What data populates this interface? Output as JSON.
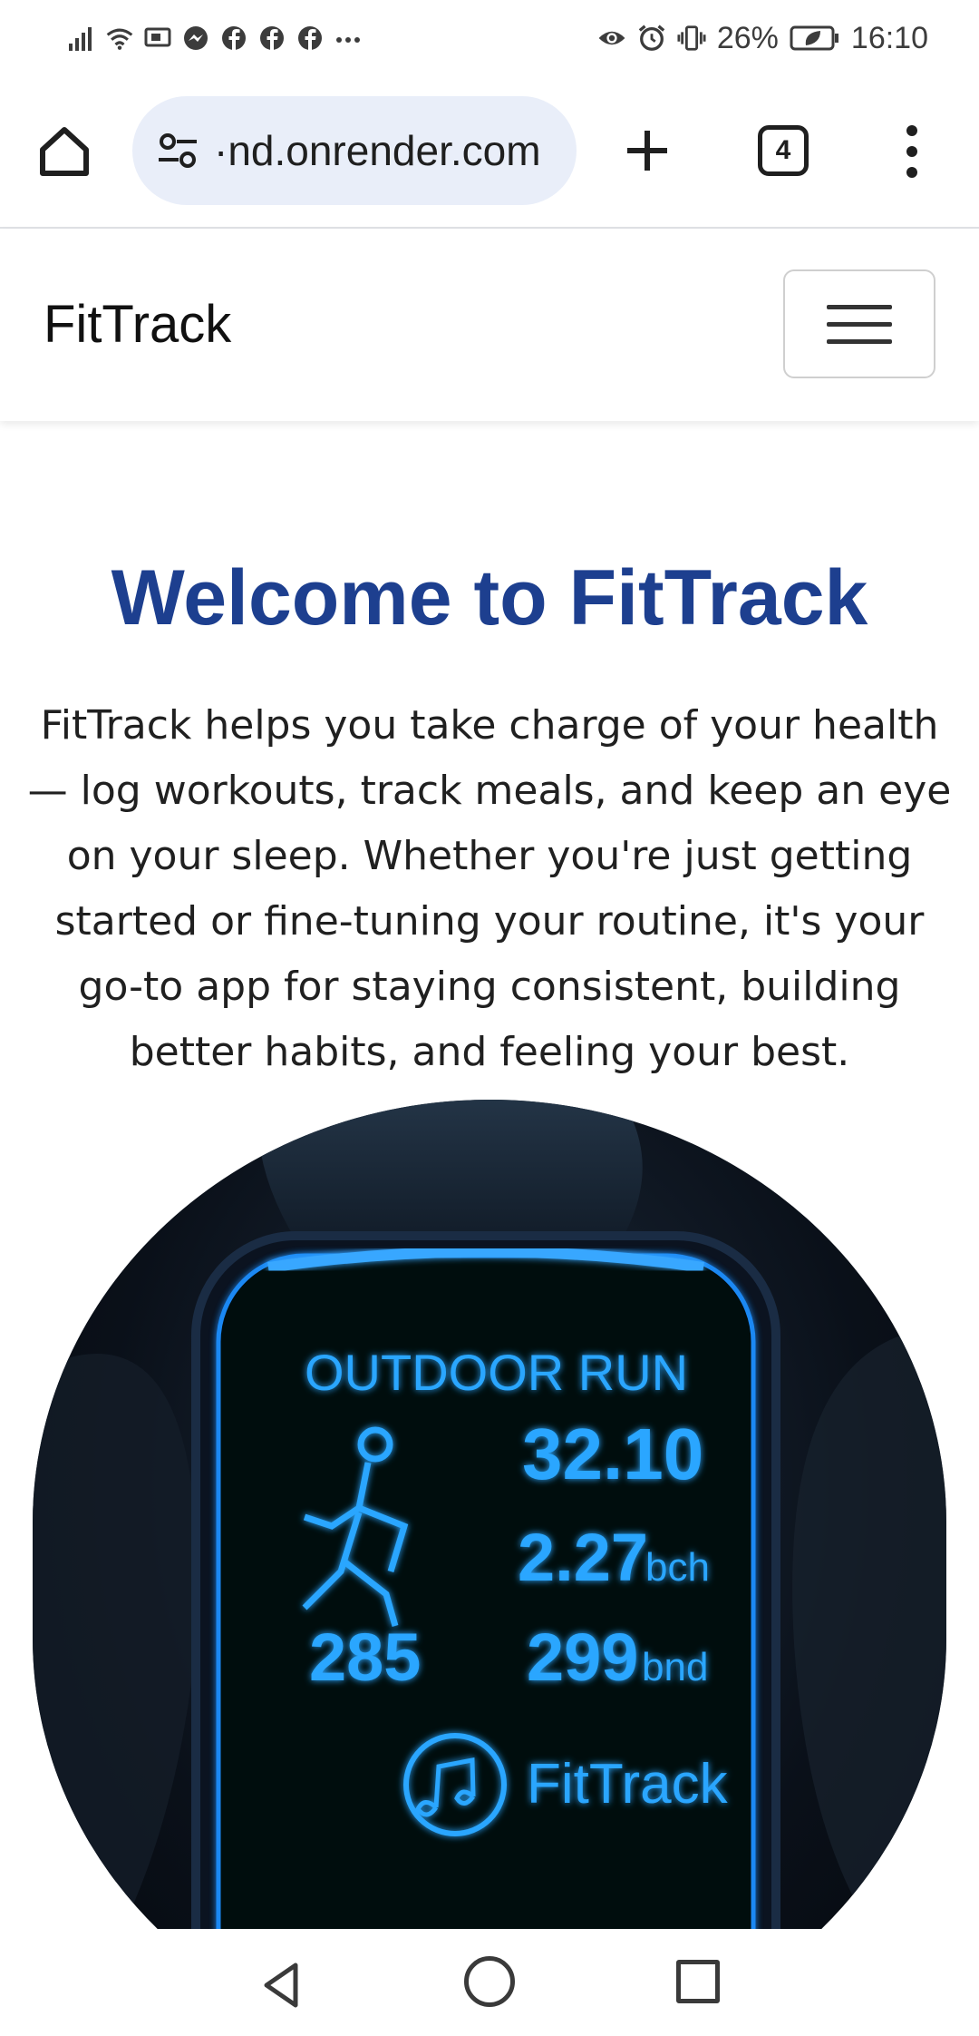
{
  "status_bar": {
    "battery": "26%",
    "time": "16:10",
    "left_icons": [
      "signal-icon",
      "wifi-icon",
      "cast-icon",
      "messenger-icon",
      "facebook-icon",
      "facebook-icon",
      "facebook-icon",
      "more-dots-icon"
    ],
    "right_icons": [
      "eye-icon",
      "alarm-icon",
      "vibrate-icon",
      "battery-icon"
    ]
  },
  "browser": {
    "url": "·nd.onrender.com",
    "tab_count": "4"
  },
  "navbar": {
    "brand": "FitTrack"
  },
  "main": {
    "title": "Welcome to FitTrack",
    "intro": "FitTrack helps you take charge of your health — log workouts, track meals, and keep an eye on your sleep. Whether you're just getting started or fine-tuning your routine, it's your go-to app for staying consistent, building better habits, and feeling your best."
  },
  "hero": {
    "screen_title": "OUTDOOR RUN",
    "metric_1": "32.10",
    "metric_2": "2.27",
    "metric_2_unit": "bch",
    "metric_3": "285",
    "metric_4": "299",
    "metric_4_unit": "bnd",
    "brand": "FitTrack"
  },
  "colors": {
    "title": "#1d3f8f",
    "url_pill": "#e9eef9",
    "watch_glow": "#1e90ff"
  }
}
